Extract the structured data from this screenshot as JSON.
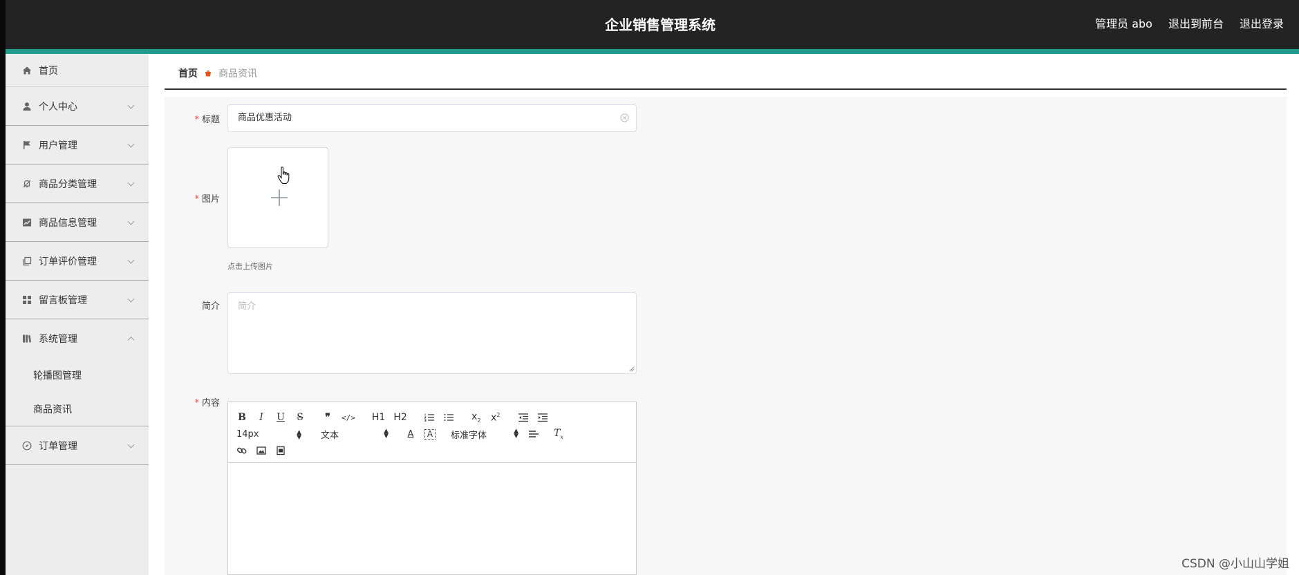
{
  "app": {
    "title": "企业销售管理系统"
  },
  "top_links": [
    {
      "label": "管理员 abo"
    },
    {
      "label": "退出到前台"
    },
    {
      "label": "退出登录"
    }
  ],
  "sidebar": {
    "items": [
      {
        "label": "首页",
        "icon": "home-icon"
      },
      {
        "label": "个人中心",
        "icon": "user-icon"
      },
      {
        "label": "用户管理",
        "icon": "flag-icon"
      },
      {
        "label": "商品分类管理",
        "icon": "bell-off-icon"
      },
      {
        "label": "商品信息管理",
        "icon": "chart-icon"
      },
      {
        "label": "订单评价管理",
        "icon": "copy-icon"
      },
      {
        "label": "留言板管理",
        "icon": "grid-icon"
      },
      {
        "label": "系统管理",
        "icon": "book-icon",
        "expanded": true,
        "children": [
          {
            "label": "轮播图管理"
          },
          {
            "label": "商品资讯"
          }
        ]
      },
      {
        "label": "订单管理",
        "icon": "compass-icon"
      }
    ]
  },
  "breadcrumb": {
    "home": "首页",
    "current": "商品资讯"
  },
  "form": {
    "title_label": "标题",
    "title_value": "商品优惠活动",
    "image_label": "图片",
    "upload_tip": "点击上传图片",
    "intro_label": "简介",
    "intro_placeholder": "简介",
    "content_label": "内容"
  },
  "editor": {
    "font_size": "14px",
    "header_select": "文本",
    "font_family": "标准字体",
    "h1": "H1",
    "h2": "H2"
  },
  "watermark": "CSDN @小山山学姐",
  "colors": {
    "topbar": "#232323",
    "accent": "#1f9c8e",
    "required": "#e25252",
    "breadcrumb_icon": "#e2541a"
  }
}
